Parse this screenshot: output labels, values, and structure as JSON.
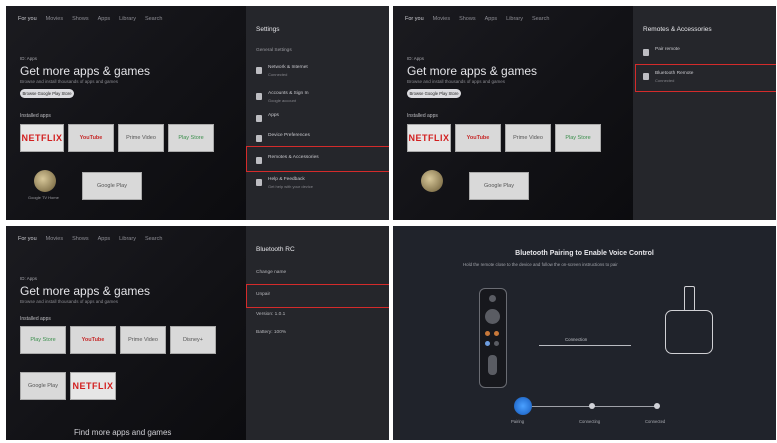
{
  "home": {
    "nav": [
      "For you",
      "Movies",
      "Shows",
      "Apps",
      "Library",
      "Search"
    ],
    "eyebrow": "ID: Apps",
    "headline": "Get more apps & games",
    "subline": "Browse and install thousands of apps and games",
    "cta": "Browse Google Play Store",
    "row_label": "Installed apps",
    "tiles": {
      "netflix": "NETFLIX",
      "youtube": "YouTube",
      "prime": "Prime Video",
      "play": "Play Store",
      "tile5": "Google Play",
      "disney": "Disney+"
    },
    "avatar_caption": "Google TV Home",
    "bottom_text": "Find more apps and games"
  },
  "settings_panel": {
    "title": "Settings",
    "subtitle": "General Settings",
    "items": [
      {
        "title": "Network & Internet",
        "desc": "Connected"
      },
      {
        "title": "Accounts & Sign In",
        "desc": "Google account"
      },
      {
        "title": "Apps",
        "desc": ""
      },
      {
        "title": "Device Preferences",
        "desc": ""
      },
      {
        "title": "Remotes & Accessories",
        "desc": ""
      },
      {
        "title": "Help & Feedback",
        "desc": "Get help with your device"
      }
    ]
  },
  "remotes_panel": {
    "title": "Remotes & Accessories",
    "items": [
      {
        "title": "Pair remote",
        "desc": ""
      },
      {
        "title": "Bluetooth Remote",
        "desc": "Connected"
      }
    ]
  },
  "bluetooth_panel": {
    "title": "Bluetooth RC",
    "items": [
      "Change name",
      "Unpair",
      "Version: 1.0.1",
      "Battery: 100%"
    ]
  },
  "pairing": {
    "title": "Bluetooth Pairing to Enable Voice Control",
    "desc": "Hold the remote close to the device and follow the on-screen instructions to pair",
    "connection_label": "Connection",
    "steps": [
      "Pairing",
      "Connecting",
      "Connected"
    ]
  },
  "colors": {
    "highlight": "#d42b2b",
    "active_step": "#2a76d8",
    "netflix_red": "#d21f1f"
  }
}
